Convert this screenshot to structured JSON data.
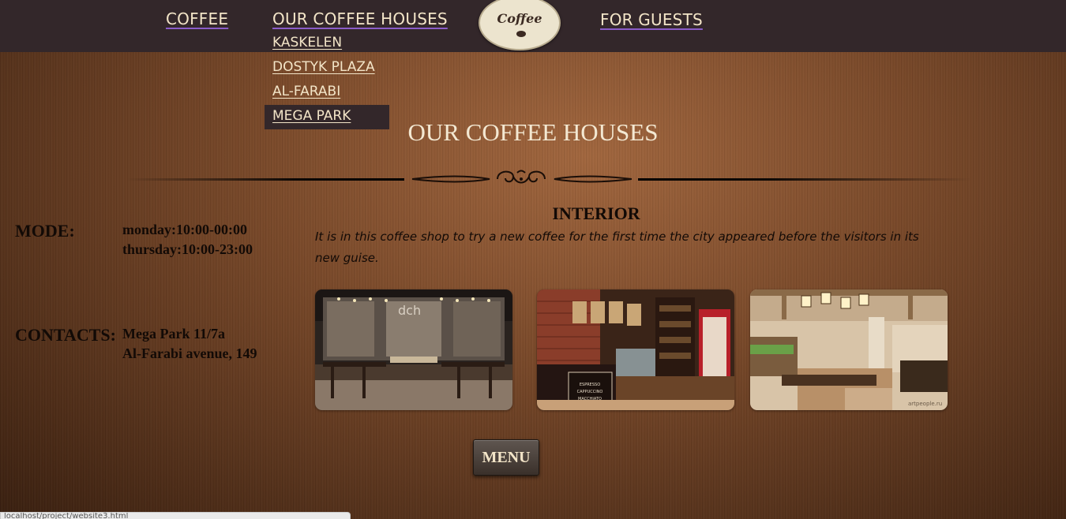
{
  "nav": {
    "coffee": "COFFEE",
    "coffee_houses": "OUR COFFEE HOUSES",
    "for_guests": "FOR GUESTS",
    "logo_text": "Coffee"
  },
  "dropdown": {
    "items": [
      {
        "label": "KASKELEN"
      },
      {
        "label": "DOSTYK PLAZA"
      },
      {
        "label": "AL-FARABI"
      },
      {
        "label": "MEGA PARK",
        "active": true
      }
    ]
  },
  "page": {
    "title": "OUR COFFEE HOUSES"
  },
  "mode": {
    "label": "MODE:",
    "line1": "monday:10:00-00:00",
    "line2": "thursday:10:00-23:00"
  },
  "contacts": {
    "label": "CONTACTS:",
    "line1": "Mega Park 11/7a",
    "line2": "Al-Farabi avenue, 149"
  },
  "interior": {
    "title": "INTERIOR",
    "text": "It is in this coffee shop to try a new coffee for the first time the city appeared before the visitors in its new guise."
  },
  "photos": {
    "photo1_sign": "dch",
    "photo2_caption1": "ESPRESSO",
    "photo2_caption2": "CAPPUCCINO",
    "photo2_caption3": "MACCHIATO",
    "photo3_watermark": "artpeople.ru"
  },
  "menu_button": {
    "label": "MENU"
  },
  "status_bar": {
    "text": "localhost/project/website3.html"
  },
  "colors": {
    "navbar": "#33272a",
    "nav_text": "#f3e5c8",
    "background_wood": "#6b4226",
    "body_text": "#120a06"
  }
}
